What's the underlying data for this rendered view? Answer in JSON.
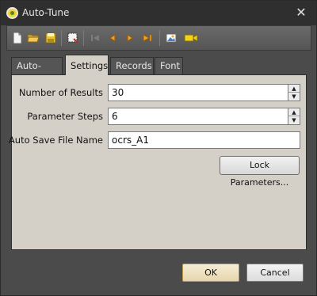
{
  "window": {
    "title": "Auto-Tune",
    "close_glyph": "✕",
    "icon": "auto-tune-app-icon"
  },
  "toolbar": {
    "buttons": [
      {
        "name": "new",
        "icon": "new-document-icon",
        "enabled": true
      },
      {
        "name": "open",
        "icon": "open-folder-icon",
        "enabled": true
      },
      {
        "name": "save",
        "icon": "save-disk-icon",
        "enabled": true
      },
      {
        "name": "parameters",
        "icon": "crop-select-icon",
        "enabled": true
      },
      {
        "name": "first",
        "icon": "first-record-icon",
        "enabled": false
      },
      {
        "name": "previous",
        "icon": "previous-record-icon",
        "enabled": true
      },
      {
        "name": "next",
        "icon": "next-record-icon",
        "enabled": true
      },
      {
        "name": "last",
        "icon": "last-record-icon",
        "enabled": true
      },
      {
        "name": "image",
        "icon": "picture-icon",
        "enabled": true
      },
      {
        "name": "video",
        "icon": "video-camera-icon",
        "enabled": true
      }
    ]
  },
  "tabs": [
    {
      "label": "Auto-Tune",
      "active": false
    },
    {
      "label": "Settings",
      "active": true
    },
    {
      "label": "Records",
      "active": false
    },
    {
      "label": "Font",
      "active": false
    }
  ],
  "settings": {
    "number_of_results": {
      "label": "Number of Results",
      "value": "30"
    },
    "parameter_steps": {
      "label": "Parameter Steps",
      "value": "6"
    },
    "auto_save_file_name": {
      "label": "Auto Save File Name",
      "value": "ocrs_A1"
    },
    "lock_parameters_label": "Lock Parameters..."
  },
  "footer": {
    "ok_label": "OK",
    "cancel_label": "Cancel"
  },
  "colors": {
    "panel": "#d4d0c8",
    "dark_chrome": "#4b4b4b",
    "ok_border": "#b89a48"
  }
}
